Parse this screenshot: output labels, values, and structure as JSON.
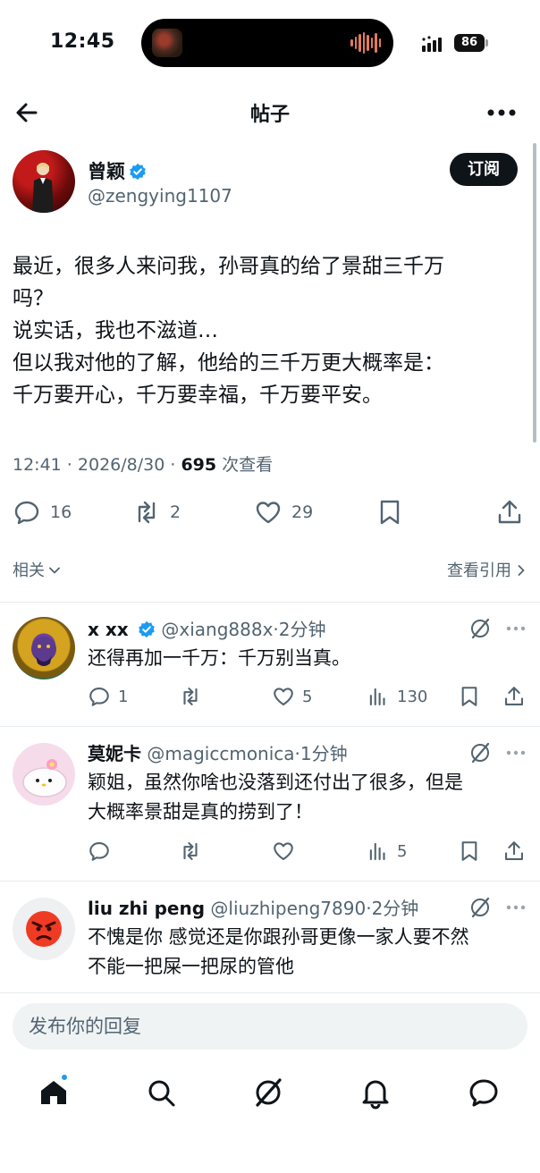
{
  "status_bar": {
    "time": "12:45",
    "battery": "86"
  },
  "header": {
    "title": "帖子"
  },
  "author": {
    "name": "曾颖",
    "handle": "@zengying1107",
    "subscribe_label": "订阅"
  },
  "post": {
    "lines": [
      "最近，很多人来问我，孙哥真的给了景甜三千万",
      "吗？",
      "说实话，我也不滋道…",
      "但以我对他的了解，他给的三千万更大概率是：",
      "千万要开心，千万要幸福，千万要平安。"
    ],
    "time": "12:41",
    "date": "2026/8/30",
    "views": "695",
    "views_label": "次查看",
    "replies": "16",
    "reposts": "2",
    "likes": "29"
  },
  "related": {
    "label": "相关",
    "quotes_label": "查看引用"
  },
  "replies": [
    {
      "name": "x xx",
      "handle": "@xiang888x",
      "time": "2分钟",
      "lines": [
        "还得再加一千万：千万别当真。"
      ],
      "replies": "1",
      "reposts": "",
      "likes": "5",
      "views": "130"
    },
    {
      "name": "莫妮卡",
      "handle": "@magiccmonica",
      "time": "1分钟",
      "lines": [
        "颖姐，虽然你啥也没落到还付出了很多，但是",
        "大概率景甜是真的捞到了！"
      ],
      "replies": "",
      "reposts": "",
      "likes": "",
      "views": "5"
    },
    {
      "name": "liu zhi peng",
      "handle": "@liuzhipeng7890",
      "time": "2分钟",
      "lines": [
        "不愧是你 感觉还是你跟孙哥更像一家人要不然",
        "不能一把屎一把尿的管他"
      ]
    }
  ],
  "compose": {
    "placeholder": "发布你的回复"
  },
  "colors": {
    "accent": "#1d9bf0",
    "text": "#0f1419",
    "muted": "#536471"
  },
  "icons": [
    "back-arrow-icon",
    "more-icon",
    "verified-badge-icon",
    "reply-icon",
    "repost-icon",
    "like-icon",
    "bookmark-icon",
    "share-icon",
    "views-icon",
    "grok-icon",
    "home-icon",
    "search-icon",
    "grok-tab-icon",
    "bell-icon",
    "messages-icon"
  ]
}
